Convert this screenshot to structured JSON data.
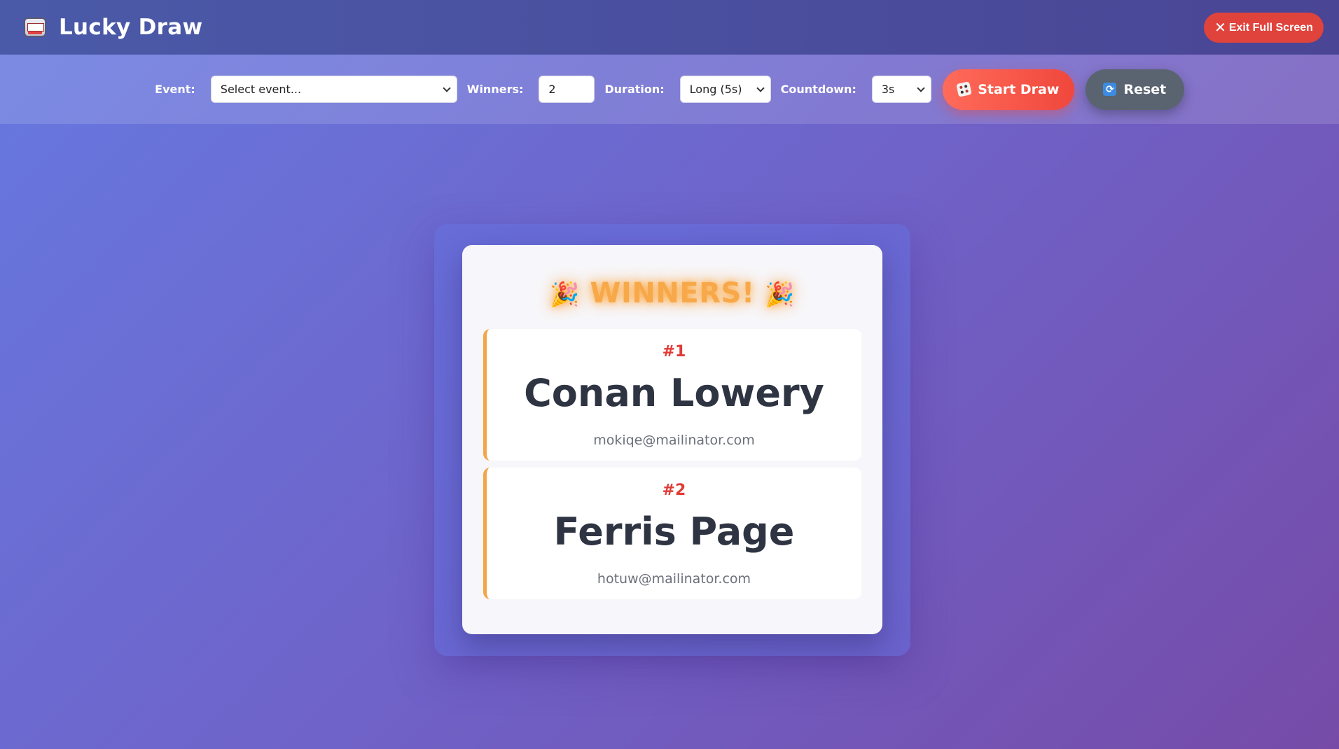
{
  "header": {
    "title": "Lucky Draw",
    "exit_label": "Exit Full Screen"
  },
  "toolbar": {
    "event_label": "Event:",
    "event_value": "Select event...",
    "winners_label": "Winners:",
    "winners_value": "2",
    "duration_label": "Duration:",
    "duration_value": "Long (5s)",
    "countdown_label": "Countdown:",
    "countdown_value": "3s",
    "start_label": "Start Draw",
    "reset_label": "Reset"
  },
  "result": {
    "heading": "WINNERS!",
    "winners": [
      {
        "rank": "#1",
        "name": "Conan Lowery",
        "email": "mokiqe@mailinator.com"
      },
      {
        "rank": "#2",
        "name": "Ferris Page",
        "email": "hotuw@mailinator.com"
      }
    ]
  },
  "icons": {
    "brand": "slot-machine-icon",
    "start": "dice-icon",
    "reset": "refresh-icon",
    "exit": "close-icon",
    "heading": "party-popper-icon"
  },
  "colors": {
    "primary_gradient_start": "#667eea",
    "primary_gradient_end": "#764ba2",
    "start_button": "#f0473c",
    "reset_button": "#5a6470",
    "exit_button": "#e0433c",
    "winner_accent": "#f2a64a",
    "rank_color": "#e03b36"
  }
}
